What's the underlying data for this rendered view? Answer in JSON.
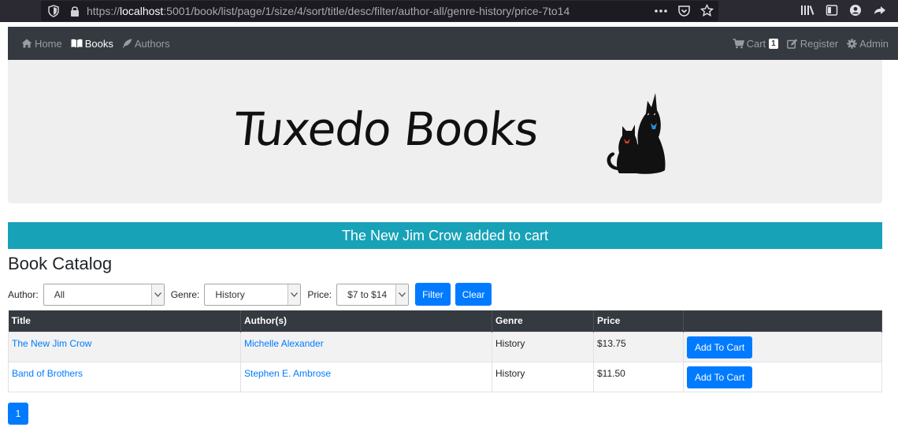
{
  "browser": {
    "url_prefix": "https://",
    "url_host": "localhost",
    "url_rest": ":5001/book/list/page/1/size/4/sort/title/desc/filter/author-all/genre-history/price-7to14"
  },
  "nav": {
    "home": "Home",
    "books": "Books",
    "authors": "Authors",
    "cart": "Cart",
    "cart_count": "1",
    "register": "Register",
    "admin": "Admin"
  },
  "brand": {
    "logo_text": "Tuxedo Books"
  },
  "alert": {
    "message": "The New Jim Crow added to cart",
    "color": "#17a2b8"
  },
  "catalog": {
    "heading": "Book Catalog",
    "filters": {
      "author_label": "Author:",
      "author_value": "All",
      "genre_label": "Genre:",
      "genre_value": "History",
      "price_label": "Price:",
      "price_value": "$7 to $14",
      "filter_button": "Filter",
      "clear_button": "Clear"
    },
    "columns": [
      "Title",
      "Author(s)",
      "Genre",
      "Price",
      ""
    ],
    "rows": [
      {
        "title": "The New Jim Crow",
        "author": "Michelle Alexander",
        "genre": "History",
        "price": "$13.75",
        "action": "Add To Cart"
      },
      {
        "title": "Band of Brothers",
        "author": "Stephen E. Ambrose",
        "genre": "History",
        "price": "$11.50",
        "action": "Add To Cart"
      }
    ],
    "pagination": {
      "current": "1"
    }
  },
  "colors": {
    "primary": "#007bff",
    "navbar": "#343a40",
    "info": "#17a2b8"
  }
}
